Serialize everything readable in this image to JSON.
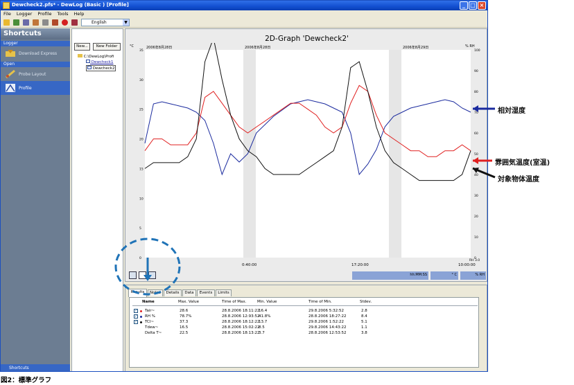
{
  "window": {
    "title": "Dewcheck2.pfs* - DewLog (Basic ) [Profile]",
    "controls": [
      "_",
      "□",
      "×"
    ]
  },
  "menu": [
    "File",
    "Logger",
    "Profile",
    "Tools",
    "Help"
  ],
  "toolbar": {
    "language": "English"
  },
  "sidebar": {
    "title": "Shortcuts",
    "categories": [
      {
        "label": "Logger",
        "items": [
          {
            "label": "Download Express",
            "icon": "download-express-icon"
          }
        ]
      },
      {
        "label": "Open",
        "items": [
          {
            "label": "Probe Layout",
            "icon": "probe-layout-icon"
          },
          {
            "label": "Profile",
            "icon": "profile-icon",
            "selected": true
          }
        ]
      }
    ],
    "footer": "Shortcuts"
  },
  "tree": {
    "buttons": [
      "New...",
      "New Folder"
    ],
    "root": "C:\\DewLog\\Profi",
    "items": [
      "Dewcheck1",
      "Dewcheck2"
    ]
  },
  "graph": {
    "title": "2D-Graph 'Dewcheck2'",
    "left_unit": "°C",
    "right_unit": "% RH",
    "top_dates": [
      "2006年8月28日",
      "2006年8月28日",
      "2006年8月29日"
    ],
    "left_ticks": [
      "35",
      "30",
      "25",
      "20",
      "15",
      "10",
      "5",
      "0"
    ],
    "right_ticks": [
      "100",
      "90",
      "80",
      "70",
      "60",
      "50",
      "40",
      "30",
      "20",
      "10",
      "0"
    ],
    "x_ticks": [
      "0:40:00",
      "17:20:00",
      "10:00:00"
    ],
    "bottom_right": "RH 3.0",
    "status_fields": [
      "hh:MM:SS",
      "° C",
      "% RH"
    ]
  },
  "chart_data": {
    "type": "line",
    "ylim_left": [
      0,
      35
    ],
    "ylim_right": [
      0,
      100
    ],
    "series": [
      {
        "name": "RH %",
        "color": "#1a2a9e",
        "values": [
          55,
          74,
          75,
          74,
          73,
          72,
          70,
          66,
          55,
          40,
          50,
          46,
          50,
          60,
          64,
          68,
          71,
          74,
          75,
          76,
          75,
          74,
          72,
          70,
          60,
          40,
          45,
          52,
          63,
          68,
          70,
          72,
          73,
          74,
          75,
          76,
          75,
          72,
          70
        ]
      },
      {
        "name": "Tair",
        "color": "#e02020",
        "values": [
          18,
          20,
          20,
          19,
          19,
          19,
          21,
          27,
          28,
          26,
          24,
          22,
          21,
          22,
          23,
          24,
          25,
          26,
          26,
          25,
          24,
          22,
          21,
          22,
          26,
          29,
          28,
          24,
          21,
          20,
          19,
          18,
          18,
          17,
          17,
          18,
          18,
          19,
          18
        ]
      },
      {
        "name": "TCI",
        "color": "#111111",
        "values": [
          15,
          16,
          16,
          16,
          16,
          17,
          20,
          33,
          37,
          30,
          24,
          20,
          18,
          17,
          15,
          14,
          14,
          14,
          14,
          15,
          16,
          17,
          18,
          22,
          32,
          33,
          28,
          22,
          18,
          16,
          15,
          14,
          13,
          13,
          13,
          13,
          13,
          14,
          18
        ]
      }
    ]
  },
  "annotations": [
    "相対湿度",
    "雰囲気温度(室温)",
    "対象物体温度"
  ],
  "tabs": [
    "Results",
    "Notes",
    "Details",
    "Data",
    "Events",
    "Limits"
  ],
  "results": {
    "headers": [
      "Name",
      "Max. Value",
      "Time of Max.",
      "Min. Value",
      "Time of Min.",
      "Stdev."
    ],
    "rows": [
      {
        "checked": true,
        "name": "Tair~",
        "max": "28.6",
        "tmax": "28.8.2006 18:11:22",
        "min": "16.4",
        "tmin": "29.8.2006 5:32:52",
        "stdev": "2.8",
        "marker": "#e02020"
      },
      {
        "checked": true,
        "name": "RH %",
        "max": "78.7%",
        "tmax": "28.8.2006 12:93:52",
        "min": "41.8%",
        "tmin": "28.8.2006 18:27:22",
        "stdev": "8.4",
        "marker": "#1a2a9e"
      },
      {
        "checked": true,
        "name": "TCI~",
        "max": "37.3",
        "tmax": "28.8.2006 18:12:22",
        "min": "13.7",
        "tmin": "29.8.2006 1:52:22",
        "stdev": "5.1",
        "marker": "#111111"
      },
      {
        "checked": false,
        "name": "Tdew~",
        "max": "16.5",
        "tmax": "28.8.2006 15:02:22",
        "min": "8.5",
        "tmin": "29.8.2006 14:43:22",
        "stdev": "1.1",
        "marker": ""
      },
      {
        "checked": false,
        "name": "Delta T~",
        "max": "22.5",
        "tmax": "28.8.2006 18:13:22",
        "min": "3.7",
        "tmin": "28.8.2006 12:53:52",
        "stdev": "3.8",
        "marker": ""
      }
    ]
  },
  "caption": "図2：標準グラフ"
}
